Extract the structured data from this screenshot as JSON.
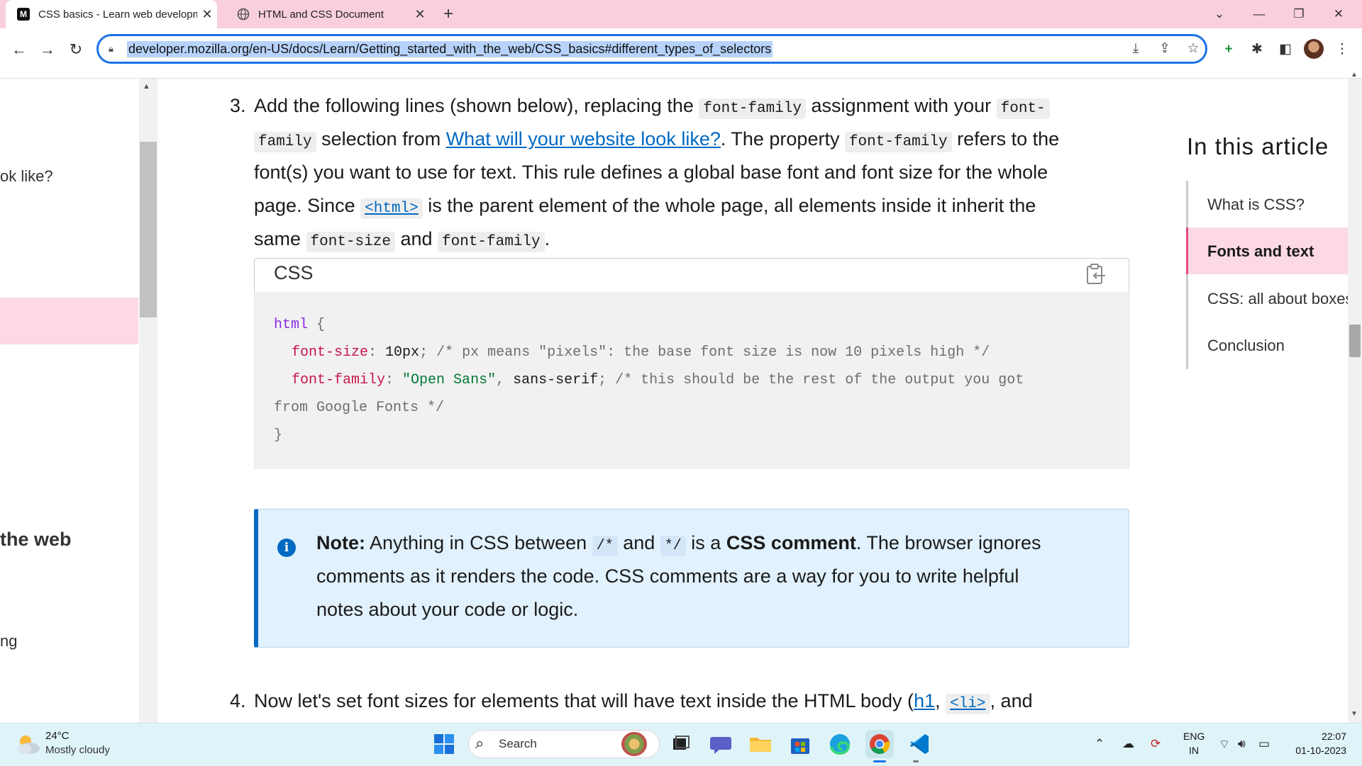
{
  "browser": {
    "tabs": [
      {
        "favicon": "M",
        "title": "CSS basics - Learn web developme"
      },
      {
        "favicon": "globe-icon",
        "title": "HTML and CSS Document"
      }
    ],
    "url": "developer.mozilla.org/en-US/docs/Learn/Getting_started_with_the_web/CSS_basics#different_types_of_selectors"
  },
  "sidebar": {
    "fragments": [
      "ok like?",
      "the web",
      "ng"
    ]
  },
  "step3": {
    "number": "3.",
    "l1a": "Add the following lines (shown below), replacing the ",
    "l1code": "font-family",
    "l1b": " assignment with your ",
    "l1code2": "font-",
    "l2code": "family",
    "l2a": " selection from ",
    "l2link": "What will your website look like?",
    "l2b": ". The property ",
    "l2code2": "font-family",
    "l2c": " refers to the",
    "l3": "font(s) you want to use for text. This rule defines a global base font and font size for the whole",
    "l4a": "page. Since ",
    "l4code": "<html>",
    "l4b": " is the parent element of the whole page, all elements inside it inherit the",
    "l5a": "same ",
    "l5code": "font-size",
    "l5b": " and ",
    "l5code2": "font-family",
    "l5c": "."
  },
  "codeblock": {
    "language": "CSS",
    "l1sel": "html",
    "l1brace": " {",
    "l2prop": "font-size",
    "l2colon": ": ",
    "l2val": "10px",
    "l2semi": ";",
    "l2com": " /* px means \"pixels\": the base font size is now 10 pixels high */",
    "l3prop": "font-family",
    "l3colon": ": ",
    "l3str": "\"Open Sans\"",
    "l3comma": ", ",
    "l3val": "sans-serif",
    "l3semi": ";",
    "l3com": " /* this should be the rest of the output you got",
    "l4com": "from Google Fonts */",
    "l5": "}"
  },
  "note": {
    "label": "Note:",
    "l1a": " Anything in CSS between ",
    "l1code": "/*",
    "l1b": " and ",
    "l1code2": "*/",
    "l1c": " is a ",
    "l1strong": "CSS comment",
    "l1d": ". The browser ignores",
    "l2": "comments as it renders the code. CSS comments are a way for you to write helpful",
    "l3": "notes about your code or logic."
  },
  "step4": {
    "number": "4.",
    "a": "Now let's set font sizes for elements that will have text inside the HTML body (",
    "link1": "h1",
    "b": ", ",
    "code": "<li>",
    "c": ", and"
  },
  "toc": {
    "title": "In this article",
    "items": [
      "What is CSS?",
      "Fonts and text",
      "CSS: all about boxes",
      "Conclusion"
    ],
    "active_index": 1
  },
  "taskbar": {
    "weather_temp": "24°C",
    "weather_desc": "Mostly cloudy",
    "search_label": "Search",
    "lang1": "ENG",
    "lang2": "IN",
    "time": "22:07",
    "date": "01-10-2023"
  },
  "colors": {
    "tabstrip": "#f9cfde",
    "accent_link": "#0069c2",
    "toc_active": "#fcd9e5",
    "omnibox_border": "#1a73e8"
  }
}
